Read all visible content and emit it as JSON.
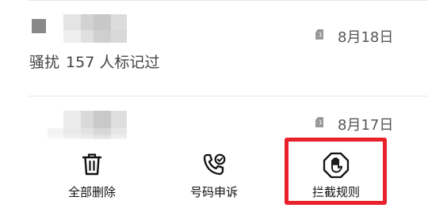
{
  "calls": [
    {
      "sim_label": "1",
      "date": "8月18日",
      "tag": "骚扰",
      "marked_count": "157",
      "marked_suffix": "人标记过"
    },
    {
      "sim_label": "1",
      "date": "8月17日"
    }
  ],
  "toolbar": {
    "delete_all_label": "全部删除",
    "appeal_label": "号码申诉",
    "rules_label": "拦截规则"
  },
  "colors": {
    "highlight": "#e8212b"
  }
}
